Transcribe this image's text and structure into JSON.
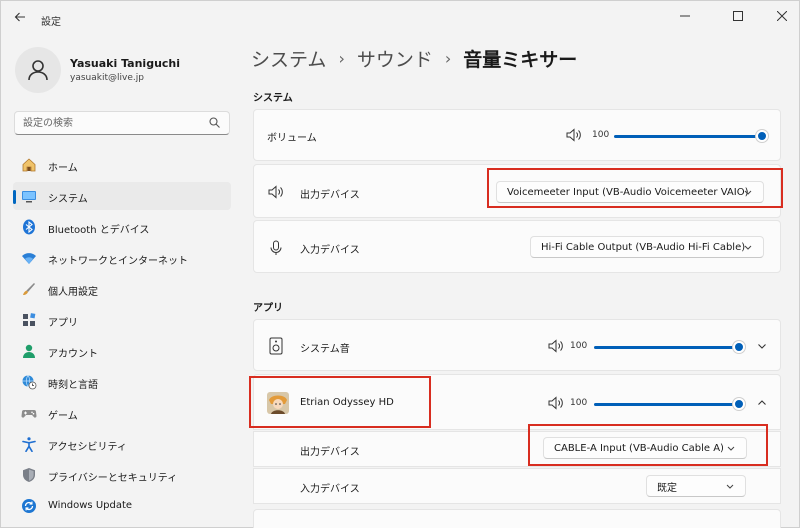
{
  "window": {
    "app_title": "設定",
    "back_icon": "back-arrow-icon"
  },
  "profile": {
    "name": "Yasuaki Taniguchi",
    "email": "yasuakit@live.jp"
  },
  "search": {
    "placeholder": "設定の検索"
  },
  "sidebar": {
    "items": [
      {
        "label": "ホーム",
        "icon": "home-icon"
      },
      {
        "label": "システム",
        "icon": "system-icon",
        "active": true
      },
      {
        "label": "Bluetooth とデバイス",
        "icon": "bluetooth-icon"
      },
      {
        "label": "ネットワークとインターネット",
        "icon": "wifi-icon"
      },
      {
        "label": "個人用設定",
        "icon": "brush-icon"
      },
      {
        "label": "アプリ",
        "icon": "apps-icon"
      },
      {
        "label": "アカウント",
        "icon": "account-icon"
      },
      {
        "label": "時刻と言語",
        "icon": "globe-clock-icon"
      },
      {
        "label": "ゲーム",
        "icon": "gamepad-icon"
      },
      {
        "label": "アクセシビリティ",
        "icon": "accessibility-icon"
      },
      {
        "label": "プライバシーとセキュリティ",
        "icon": "shield-icon"
      },
      {
        "label": "Windows Update",
        "icon": "update-icon"
      }
    ]
  },
  "breadcrumb": {
    "level1": "システム",
    "level2": "サウンド",
    "current": "音量ミキサー",
    "separator": "›"
  },
  "system_section": {
    "title": "システム",
    "volume_label": "ボリューム",
    "volume_value": "100",
    "volume_level": 1.0,
    "output_label": "出力デバイス",
    "output_value": "Voicemeeter Input (VB-Audio Voicemeeter VAIO)",
    "input_label": "入力デバイス",
    "input_value": "Hi-Fi Cable Output (VB-Audio Hi-Fi Cable)"
  },
  "apps_section": {
    "title": "アプリ",
    "system_sounds_label": "システム音",
    "system_sounds_volume": "100",
    "app_name": "Etrian Odyssey HD",
    "app_volume": "100",
    "app_output_label": "出力デバイス",
    "app_output_value": "CABLE-A Input (VB-Audio Cable A)",
    "app_input_label": "入力デバイス",
    "app_input_value": "既定"
  },
  "colors": {
    "accent": "#005fb8",
    "highlight_box": "#d82d20"
  }
}
